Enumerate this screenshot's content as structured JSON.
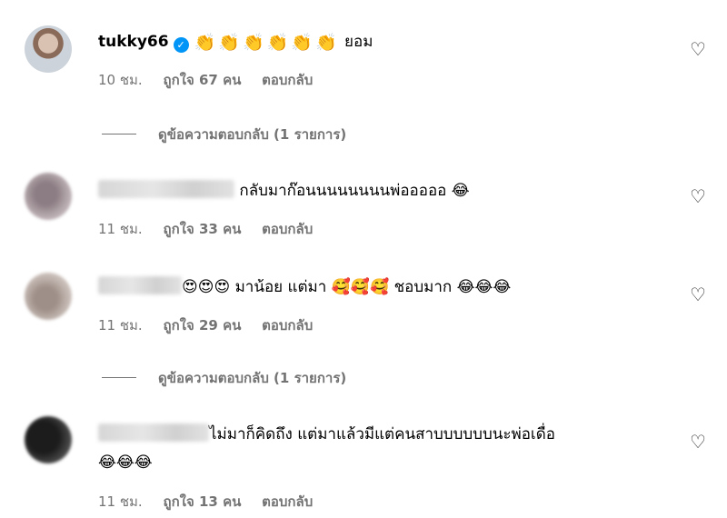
{
  "comments": [
    {
      "username": "tukky66",
      "verified": true,
      "emojis": [
        "👏",
        "👏",
        "👏",
        "👏",
        "👏",
        "👏"
      ],
      "text": "ยอม",
      "time": "10 ชม.",
      "likes": "ถูกใจ 67 คน",
      "reply": "ตอบกลับ"
    },
    {
      "text": "กลับมาก๊อนนนนนนนนพ่อออออ 😂",
      "time": "11 ชม.",
      "likes": "ถูกใจ 33 คน",
      "reply": "ตอบกลับ"
    },
    {
      "text_parts": [
        "😍😍😍",
        " มาน้อย แต่มา ",
        "🥰🥰🥰",
        " ชอบมาก ",
        "😂😂😂"
      ],
      "time": "11 ชม.",
      "likes": "ถูกใจ 29 คน",
      "reply": "ตอบกลับ"
    },
    {
      "text_line1": "ไม่มาก็คิดถึง แต่มาแล้วมีแต่คนสาบบบบบบนะพ่อเดื่อ",
      "text_line2": "😂😂😂",
      "time": "11 ชม.",
      "likes": "ถูกใจ 13 คน",
      "reply": "ตอบกลับ"
    }
  ],
  "view_replies_1": "ดูข้อความตอบกลับ (1 รายการ)",
  "view_replies_2": "ดูข้อความตอบกลับ (1 รายการ)",
  "icons": {
    "heart": "♡",
    "verified": "✓"
  }
}
